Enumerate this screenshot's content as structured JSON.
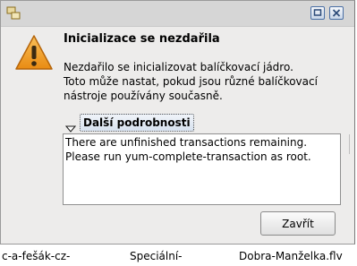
{
  "window": {
    "title_buttons": [
      "maximize-icon",
      "close-icon"
    ]
  },
  "dialog": {
    "heading": "Inicializace se nezdařila",
    "message_lines": [
      "Nezdařilo se inicializovat balíčkovací jádro.",
      "Toto může nastat, pokud jsou různé balíčkovací",
      "nástroje používány současně."
    ],
    "expander_label": "Další podrobnosti",
    "details_lines": [
      "There are unfinished transactions remaining.",
      "Please run yum-complete-transaction as root."
    ],
    "close_label": "Zavřít"
  },
  "background": {
    "fragments": [
      "c-a-fešák-cz-",
      "Speciální-",
      "Dobra-Manželka.flv"
    ]
  },
  "colors": {
    "warning": "#f5a623",
    "dialog_bg": "#edeceb",
    "title_bg": "#d6d6d6"
  }
}
